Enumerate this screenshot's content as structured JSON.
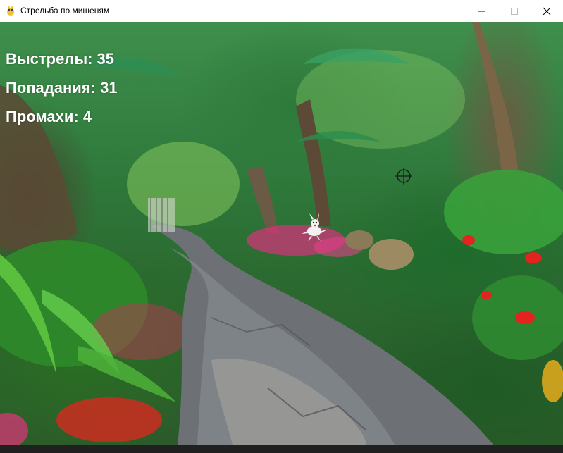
{
  "window": {
    "title": "Стрельба по мишеням",
    "controls": {
      "minimize_icon": "minimize-icon",
      "maximize_icon": "maximize-icon",
      "close_icon": "close-icon"
    }
  },
  "hud": {
    "shots_label": "Выстрелы: 35",
    "hits_label": "Попадания: 31",
    "misses_label": "Промахи: 4"
  },
  "game": {
    "background": "garden path scene",
    "crosshair_icon": "crosshair-icon",
    "target_icon": "target-sprite"
  },
  "colors": {
    "hud_text": "#ffffff",
    "titlebar_bg": "#ffffff",
    "bottom_bar": "#202020"
  }
}
